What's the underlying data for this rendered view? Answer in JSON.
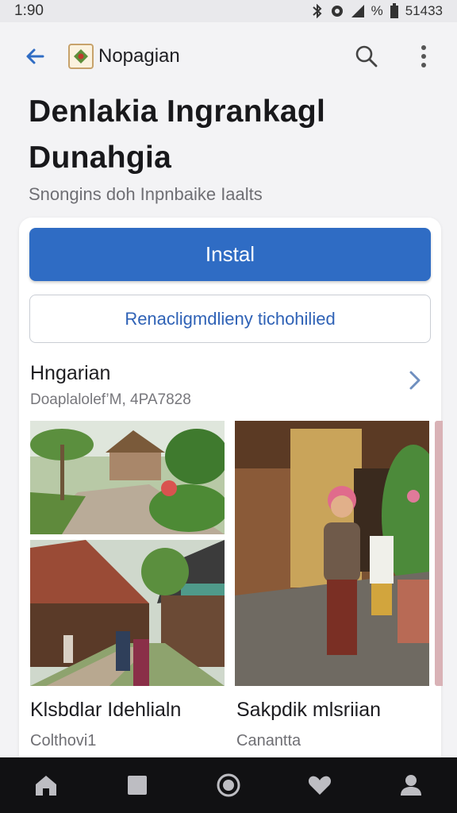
{
  "status": {
    "time": "1:90",
    "battery_text": "%",
    "signal_text": "51433"
  },
  "app": {
    "name": "Nopagian"
  },
  "page": {
    "title": "Denlakia Ingrankagl Dunahgia",
    "subtitle": "Snongins doh Inpnbaike Iaalts"
  },
  "actions": {
    "install_label": "Instal",
    "secondary_label": "Renacligmdlieny tichohilied"
  },
  "section": {
    "title": "Hngarian",
    "meta": "Doaplalolef’M, 4PA7828"
  },
  "gallery": [
    {
      "title": "Klsbdlar Idehlialn",
      "subtitle": "Colthovi1"
    },
    {
      "title": "Sakpdik mlsriian",
      "subtitle": "Canantta"
    }
  ],
  "colors": {
    "accent": "#2f6cc4",
    "nav_bg": "#111113",
    "link": "#2f62b6"
  },
  "icons": [
    "back-arrow-icon",
    "app-logo-icon",
    "search-icon",
    "more-vert-icon",
    "chevron-right-icon",
    "home-icon",
    "stop-icon",
    "circle-icon",
    "heart-icon",
    "person-icon"
  ]
}
